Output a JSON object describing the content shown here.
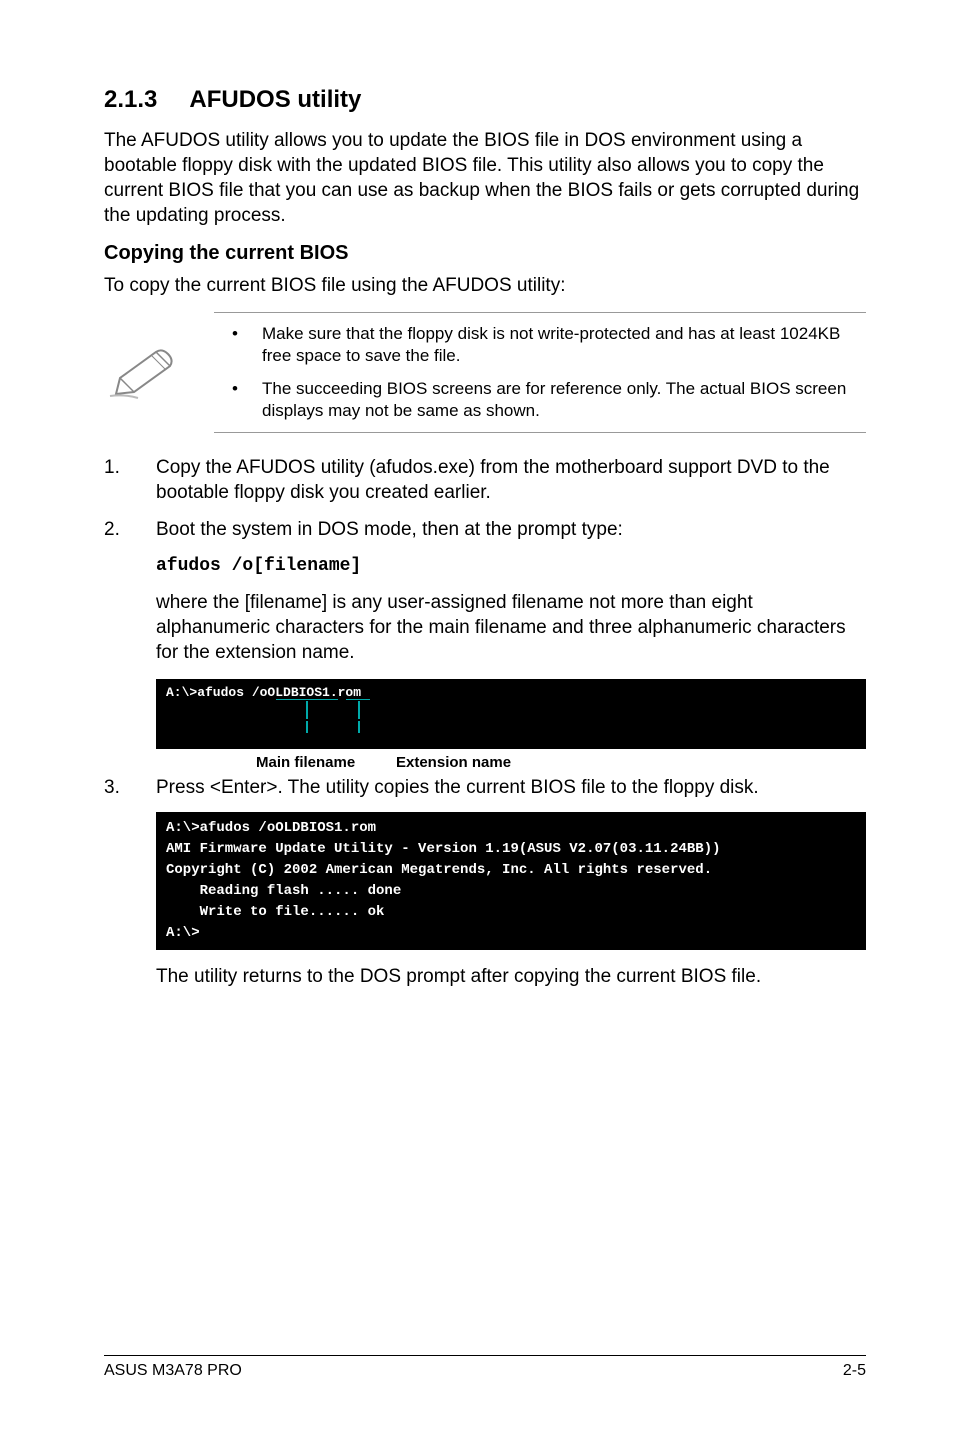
{
  "heading": {
    "number": "2.1.3",
    "title": "AFUDOS utility"
  },
  "intro": "The AFUDOS utility allows you to update the BIOS file in DOS environment using a bootable floppy disk with the updated BIOS file. This utility also allows you to copy the current BIOS file that you can use as backup when the BIOS fails or gets corrupted during the updating process.",
  "sub_heading": "Copying the current BIOS",
  "sub_intro": "To copy the current BIOS file using the AFUDOS utility:",
  "notes": [
    "Make sure that the floppy disk is not write-protected and has at least 1024KB free space to save the file.",
    "The succeeding BIOS screens are for reference only. The actual BIOS screen displays may not be same as shown."
  ],
  "step1": {
    "num": "1.",
    "text": "Copy the AFUDOS utility (afudos.exe) from the motherboard support DVD to the bootable floppy disk you created earlier."
  },
  "step2": {
    "num": "2.",
    "text": "Boot the system in DOS mode, then at the prompt type:"
  },
  "code": "afudos /o[filename]",
  "where_para": "where the [filename] is any user-assigned filename not more than eight alphanumeric characters  for the main filename and three alphanumeric characters for the extension name.",
  "diagram": {
    "command": "A:\\>afudos /oOLDBIOS1.rom",
    "main_label": "Main filename",
    "ext_label": "Extension name"
  },
  "step3": {
    "num": "3.",
    "text": "Press <Enter>. The utility copies the current BIOS file to the floppy disk."
  },
  "terminal2": "A:\\>afudos /oOLDBIOS1.rom\nAMI Firmware Update Utility - Version 1.19(ASUS V2.07(03.11.24BB))\nCopyright (C) 2002 American Megatrends, Inc. All rights reserved.\n    Reading flash ..... done\n    Write to file...... ok\nA:\\>",
  "return_para": "The utility returns to the DOS prompt after copying the current BIOS file.",
  "footer": {
    "left": "ASUS M3A78 PRO",
    "right": "2-5"
  }
}
